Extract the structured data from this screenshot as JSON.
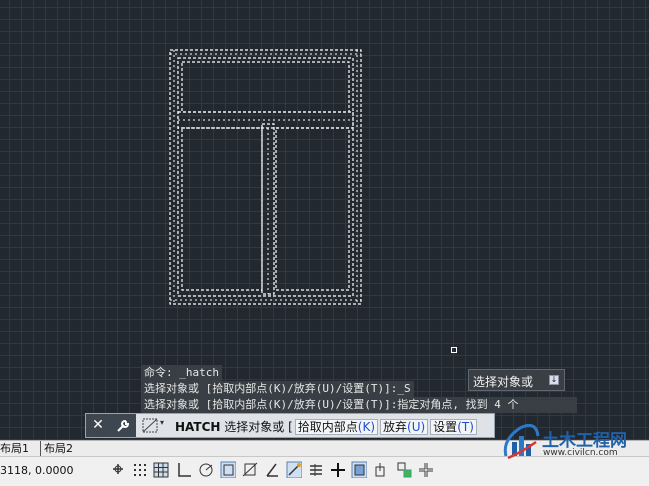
{
  "command_history": {
    "line1": "命令: _hatch",
    "line2": "选择对象或 [拾取内部点(K)/放弃(U)/设置(T)]:_S",
    "line3": "选择对象或 [拾取内部点(K)/放弃(U)/设置(T)]:指定对角点, 找到 4 个"
  },
  "tooltip": {
    "text": "选择对象或",
    "button_glyph": "↓"
  },
  "command_line": {
    "close_glyph": "✕",
    "wrench_glyph": "🔧",
    "command": "HATCH",
    "prompt": " 选择对象或 [",
    "options": [
      {
        "label": "拾取内部点",
        "key": "(K)"
      },
      {
        "label": "放弃",
        "key": "(U)"
      },
      {
        "label": "设置",
        "key": "(T)"
      }
    ]
  },
  "layout_tabs": [
    "布局1",
    "布局2"
  ],
  "status": {
    "coordinates": "3118, 0.0000"
  },
  "watermark": {
    "name": "土木工程网",
    "url": "www.civilcn.com"
  },
  "icons": [
    "hatch-icon",
    "infer-constraint-icon",
    "snap-icon",
    "grid-icon",
    "ortho-icon",
    "polar-icon",
    "osnap-icon",
    "otrack-icon",
    "ducs-icon",
    "dyn-icon",
    "lineweight-icon",
    "transparency-icon",
    "selection-cycling-icon",
    "annotation-monitor-icon",
    "quick-properties-icon"
  ],
  "colors": {
    "canvas_bg": "#212830",
    "grid": "#2f3844",
    "selection_dashes": "#ffffff",
    "command_bar": "#dfe3e8",
    "option_key": "#1f4fd0",
    "logo_blue": "#2061a8"
  }
}
